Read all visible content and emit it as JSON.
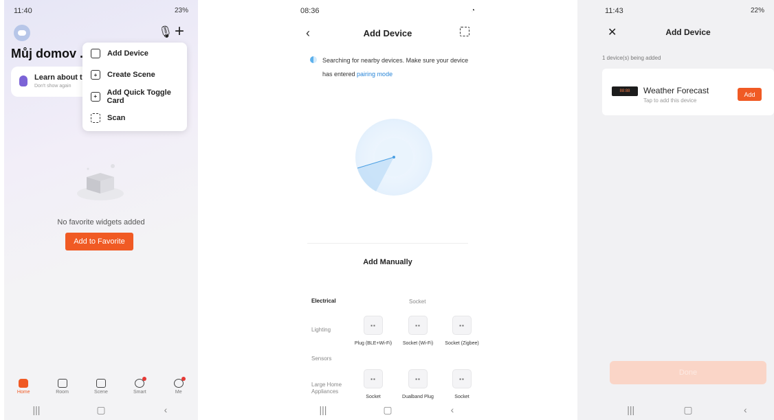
{
  "phone1": {
    "status_time": "11:40",
    "status_right": "23%",
    "home_title": "Můj domov ...",
    "learn_card": {
      "title": "Learn about th",
      "subtitle": "Don't show again"
    },
    "menu": [
      {
        "icon": "add-device-icon",
        "label": "Add Device"
      },
      {
        "icon": "create-scene-icon",
        "label": "Create Scene"
      },
      {
        "icon": "quick-toggle-icon",
        "label": "Add Quick Toggle Card"
      },
      {
        "icon": "scan-icon",
        "label": "Scan"
      }
    ],
    "empty_text": "No favorite widgets added",
    "add_favorite": "Add to Favorite",
    "tabs": [
      {
        "label": "Home",
        "active": true
      },
      {
        "label": "Room"
      },
      {
        "label": "Scene"
      },
      {
        "label": "Smart",
        "badge": true
      },
      {
        "label": "Me",
        "badge": true
      }
    ],
    "accent": "#f05a24"
  },
  "phone2": {
    "status_time": "08:36",
    "title": "Add Device",
    "search_text": "Searching for nearby devices. Make sure your device has entered ",
    "search_link": "pairing mode",
    "manual_title": "Add Manually",
    "categories": [
      "Electrical",
      "Lighting",
      "Sensors",
      "Large Home Appliances"
    ],
    "socket_header": "Socket",
    "devices": [
      {
        "name": "Plug (BLE+Wi-Fi)"
      },
      {
        "name": "Socket (Wi-Fi)"
      },
      {
        "name": "Socket (Zigbee)"
      },
      {
        "name": "Socket"
      },
      {
        "name": "Dualband Plug"
      },
      {
        "name": "Socket"
      }
    ]
  },
  "phone3": {
    "status_time": "11:43",
    "status_right": "22%",
    "title": "Add Device",
    "adding_text": "1 device(s) being added",
    "device_name": "Weather Forecast",
    "device_hint": "Tap to add this device",
    "add_label": "Add",
    "done_label": "Done"
  }
}
